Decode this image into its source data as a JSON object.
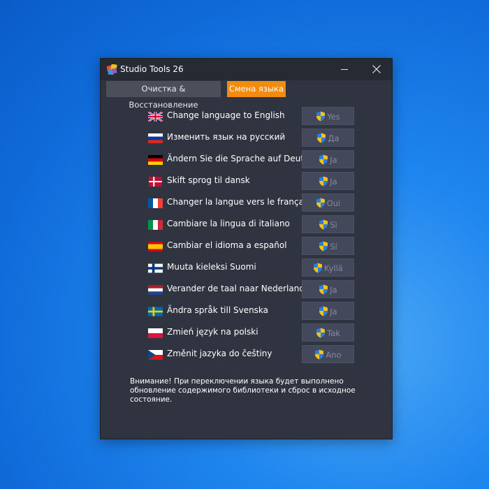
{
  "window": {
    "title": "Studio Tools 26",
    "controls": {
      "minimize": "minimize",
      "close": "close"
    }
  },
  "tabs": [
    {
      "label": "Очистка & Восстановление",
      "active": false
    },
    {
      "label": "Смена языка",
      "active": true,
      "accent": "#f28c0e"
    }
  ],
  "languages": [
    {
      "flag": "uk-flag",
      "label": "Change language to English",
      "button": "Yes"
    },
    {
      "flag": "russia-flag",
      "label": "Изменить язык на русский",
      "button": "Да"
    },
    {
      "flag": "germany-flag",
      "label": "Ändern Sie die Sprache auf Deutsch",
      "button": "Ja"
    },
    {
      "flag": "denmark-flag",
      "label": "Skift sprog til dansk",
      "button": "Ja"
    },
    {
      "flag": "france-flag",
      "label": "Changer la langue vers le français",
      "button": "Oui"
    },
    {
      "flag": "italy-flag",
      "label": "Cambiare la lingua di italiano",
      "button": "Sì"
    },
    {
      "flag": "spain-flag",
      "label": "Cambiar el idioma a español",
      "button": "Sí"
    },
    {
      "flag": "finland-flag",
      "label": "Muuta kieleksi Suomi",
      "button": "Kyllä"
    },
    {
      "flag": "netherlands-flag",
      "label": "Verander de taal naar Nederlands",
      "button": "Ja"
    },
    {
      "flag": "sweden-flag",
      "label": "Ändra språk till Svenska",
      "button": "Ja"
    },
    {
      "flag": "poland-flag",
      "label": "Zmień język na polski",
      "button": "Tak"
    },
    {
      "flag": "czech-flag",
      "label": "Změnit jazyka do češtiny",
      "button": "Ano"
    }
  ],
  "warning": "Внимание! При переключении языка будет выполнено обновление содержимого библиотеки и сброс в исходное состояние.",
  "colors": {
    "window_bg": "#2f3440",
    "titlebar_bg": "#262a33",
    "button_bg": "#43495a",
    "button_text": "#848b9a",
    "accent": "#f28c0e",
    "desktop": "#1f86ef"
  }
}
